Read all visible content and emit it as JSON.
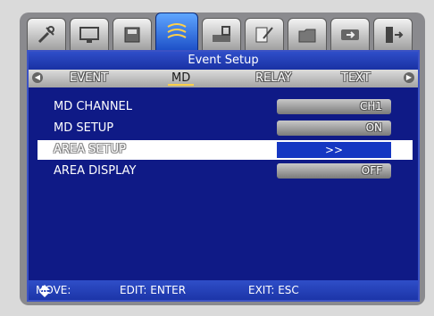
{
  "icons": [
    {
      "name": "tools-icon"
    },
    {
      "name": "monitor-icon"
    },
    {
      "name": "storage-icon"
    },
    {
      "name": "event-icon"
    },
    {
      "name": "network-icon"
    },
    {
      "name": "checklist-icon"
    },
    {
      "name": "folder-icon"
    },
    {
      "name": "backup-icon"
    },
    {
      "name": "exit-icon"
    }
  ],
  "title": "Event Setup",
  "tabs": [
    "EVENT",
    "MD",
    "RELAY",
    "TEXT"
  ],
  "active_tab": "MD",
  "rows": [
    {
      "label": "MD CHANNEL",
      "value": "CH1"
    },
    {
      "label": "MD SETUP",
      "value": "ON"
    },
    {
      "label": "AREA SETUP",
      "value": ">>"
    },
    {
      "label": "AREA DISPLAY",
      "value": "OFF"
    }
  ],
  "footer": {
    "move": "MOVE:",
    "edit": "EDIT: ENTER",
    "exit": "EXIT: ESC"
  },
  "colors": {
    "panel": "#0f1a86",
    "highlight": "#ffffff",
    "selected_value": "#1537c2"
  }
}
